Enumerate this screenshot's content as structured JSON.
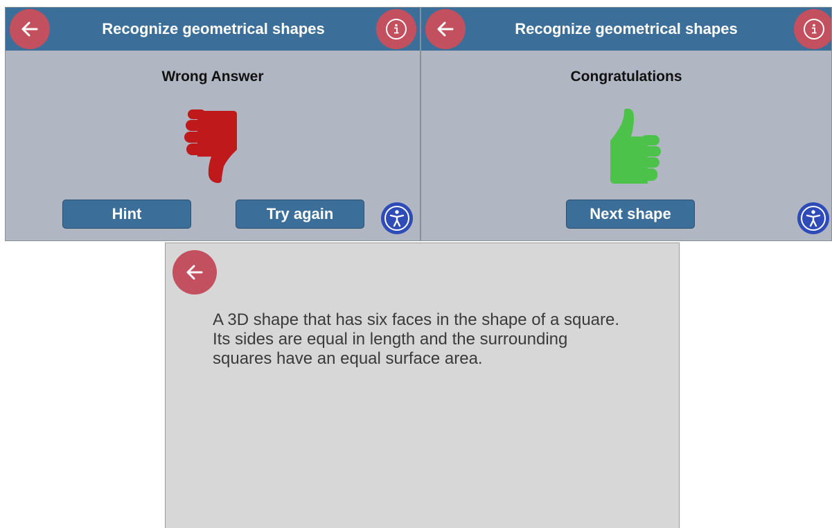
{
  "screens": {
    "wrong": {
      "title": "Recognize geometrical shapes",
      "message": "Wrong Answer",
      "feedback_icon": "thumbs-down-icon",
      "feedback_color": "#c0191b",
      "buttons": {
        "hint": "Hint",
        "try_again": "Try again"
      }
    },
    "correct": {
      "title": "Recognize geometrical shapes",
      "message": "Congratulations",
      "feedback_icon": "thumbs-up-icon",
      "feedback_color": "#4cc24a",
      "buttons": {
        "next_shape": "Next shape"
      }
    },
    "hint": {
      "text": "A 3D shape that has six faces in the shape of a square. Its sides are equal in length and the surrounding squares have an equal surface area."
    }
  },
  "icons": {
    "back": "back-arrow-icon",
    "info": "info-icon",
    "accessibility": "accessibility-icon"
  },
  "colors": {
    "header": "#3b6e98",
    "round_button": "#c3505e",
    "background": "#b0b7c3",
    "hint_background": "#d7d7d7",
    "accessibility": "#2e4bb8"
  }
}
